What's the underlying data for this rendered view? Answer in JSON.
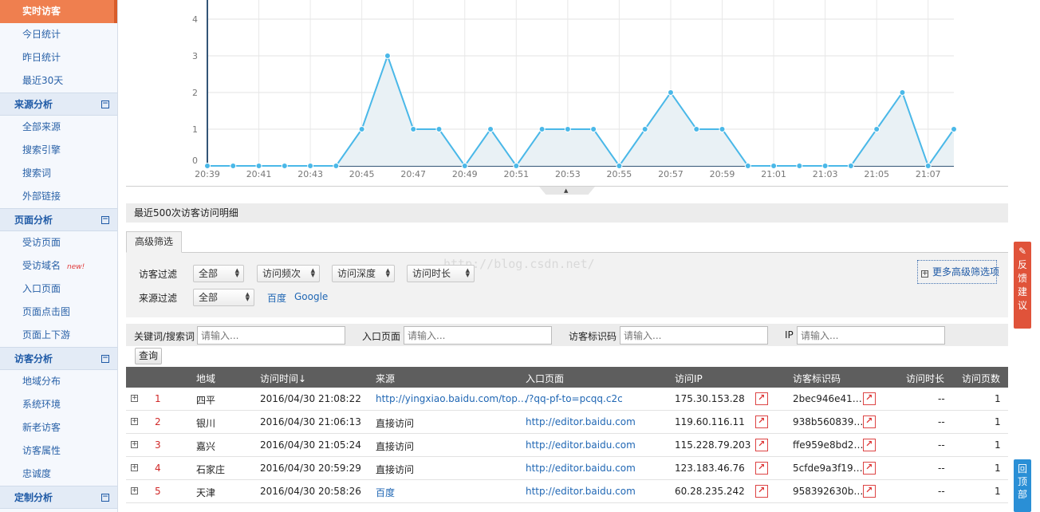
{
  "sidebar": {
    "active": "实时访客",
    "group0": [
      "今日统计",
      "昨日统计",
      "最近30天"
    ],
    "sec1": "来源分析",
    "group1": [
      "全部来源",
      "搜索引擎",
      "搜索词",
      "外部链接"
    ],
    "sec2": "页面分析",
    "group2a": "受访页面",
    "group2b": "受访域名",
    "new_badge": "new!",
    "group2c": [
      "入口页面",
      "页面点击图",
      "页面上下游"
    ],
    "sec3": "访客分析",
    "group3": [
      "地域分布",
      "系统环境",
      "新老访客",
      "访客属性",
      "忠诚度"
    ],
    "sec4": "定制分析",
    "toggle": "−"
  },
  "chart_data": {
    "type": "area",
    "x": [
      "20:39",
      "20:40",
      "20:41",
      "20:42",
      "20:43",
      "20:44",
      "20:45",
      "20:46",
      "20:47",
      "20:48",
      "20:49",
      "20:50",
      "20:51",
      "20:52",
      "20:53",
      "20:54",
      "20:55",
      "20:56",
      "20:57",
      "20:58",
      "20:59",
      "21:00",
      "21:01",
      "21:02",
      "21:03",
      "21:04",
      "21:05",
      "21:06",
      "21:07",
      "21:08"
    ],
    "values": [
      0,
      0,
      0,
      0,
      0,
      0,
      1,
      3,
      1,
      1,
      0,
      1,
      0,
      1,
      1,
      1,
      0,
      1,
      2,
      1,
      1,
      0,
      0,
      0,
      0,
      0,
      1,
      2,
      0,
      1
    ],
    "xtick_labels": [
      "20:39",
      "20:41",
      "20:43",
      "20:45",
      "20:47",
      "20:49",
      "20:51",
      "20:53",
      "20:55",
      "20:57",
      "20:59",
      "21:01",
      "21:03",
      "21:05",
      "21:07"
    ],
    "ylim": [
      0,
      4
    ],
    "yticks": [
      "0",
      "1",
      "2",
      "3",
      "4"
    ],
    "grid": true,
    "color": "#4ab8e8"
  },
  "collapse_arrow": "▲",
  "section_title": "最近500次访客访问明细",
  "filter": {
    "tab": "高级筛选",
    "visitor_label": "访客过滤",
    "selects": [
      "全部",
      "访问频次",
      "访问深度",
      "访问时长"
    ],
    "source_label": "来源过滤",
    "source_select": "全部",
    "source_links": [
      "百度",
      "Google"
    ],
    "more": "更多高级筛选项",
    "plus": "+",
    "arrow": "▲▼"
  },
  "watermark": "http://blog.csdn.net/",
  "search": {
    "kw_label": "关键词/搜索词",
    "entry_label": "入口页面",
    "visitor_id_label": "访客标识码",
    "ip_label": "IP",
    "placeholder": "请输入...",
    "query_button": "查询"
  },
  "table": {
    "headers": [
      "地域",
      "访问时间↓",
      "来源",
      "入口页面",
      "访问IP",
      "访客标识码",
      "访问时长",
      "访问页数"
    ],
    "rows": [
      {
        "n": "1",
        "region": "四平",
        "time": "2016/04/30 21:08:22",
        "source": "http://yingxiao.baidu.com/top…",
        "source_link": true,
        "entry": "/?qq-pf-to=pcqq.c2c",
        "ip": "175.30.153.28",
        "vid": "2bec946e41…",
        "dur": "--",
        "pages": "1"
      },
      {
        "n": "2",
        "region": "银川",
        "time": "2016/04/30 21:06:13",
        "source": "直接访问",
        "source_link": false,
        "entry": "http://editor.baidu.com",
        "ip": "119.60.116.11",
        "vid": "938b560839…",
        "dur": "--",
        "pages": "1"
      },
      {
        "n": "3",
        "region": "嘉兴",
        "time": "2016/04/30 21:05:24",
        "source": "直接访问",
        "source_link": false,
        "entry": "http://editor.baidu.com",
        "ip": "115.228.79.203",
        "vid": "ffe959e8bd2…",
        "dur": "--",
        "pages": "1"
      },
      {
        "n": "4",
        "region": "石家庄",
        "time": "2016/04/30 20:59:29",
        "source": "直接访问",
        "source_link": false,
        "entry": "http://editor.baidu.com",
        "ip": "123.183.46.76",
        "vid": "5cfde9a3f19…",
        "dur": "--",
        "pages": "1"
      },
      {
        "n": "5",
        "region": "天津",
        "time": "2016/04/30 20:58:26",
        "source": "百度",
        "source_link": true,
        "entry": "http://editor.baidu.com",
        "ip": "60.28.235.242",
        "vid": "958392630b…",
        "dur": "--",
        "pages": "1"
      }
    ]
  },
  "feedback_tab": [
    "反",
    "馈",
    "建",
    "议"
  ],
  "feedback_icon": "✎",
  "backtop_tab": [
    "回",
    "顶",
    "部"
  ]
}
